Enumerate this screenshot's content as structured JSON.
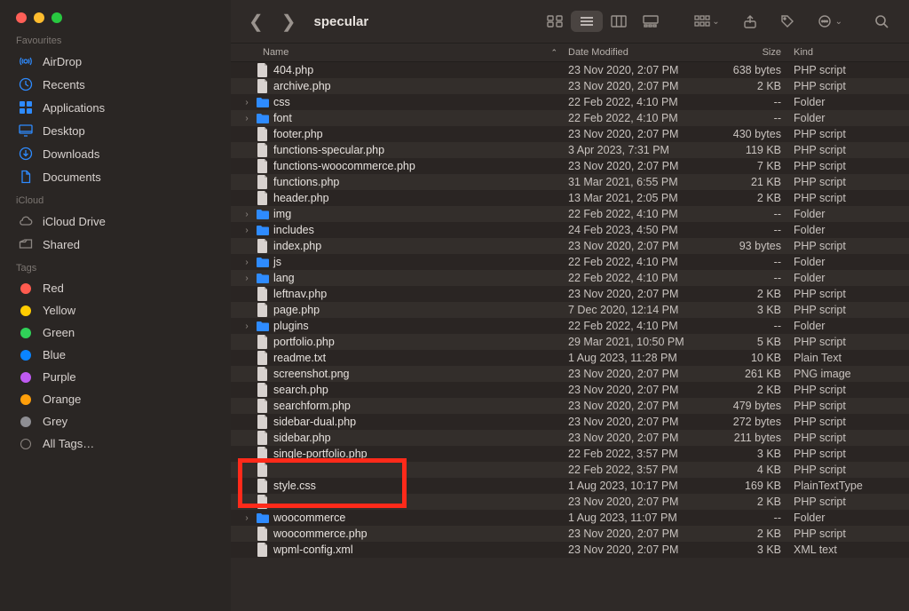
{
  "window": {
    "title": "specular"
  },
  "sidebar": {
    "sections": [
      {
        "label": "Favourites",
        "items": [
          {
            "icon": "airdrop",
            "label": "AirDrop"
          },
          {
            "icon": "clock",
            "label": "Recents"
          },
          {
            "icon": "apps",
            "label": "Applications"
          },
          {
            "icon": "desktop",
            "label": "Desktop"
          },
          {
            "icon": "download",
            "label": "Downloads"
          },
          {
            "icon": "doc",
            "label": "Documents"
          }
        ]
      },
      {
        "label": "iCloud",
        "items": [
          {
            "icon": "cloud",
            "label": "iCloud Drive"
          },
          {
            "icon": "shared",
            "label": "Shared"
          }
        ]
      },
      {
        "label": "Tags",
        "items": [
          {
            "icon": "dot",
            "color": "#ff5b4f",
            "label": "Red"
          },
          {
            "icon": "dot",
            "color": "#ffcc00",
            "label": "Yellow"
          },
          {
            "icon": "dot",
            "color": "#30d158",
            "label": "Green"
          },
          {
            "icon": "dot",
            "color": "#0a84ff",
            "label": "Blue"
          },
          {
            "icon": "dot",
            "color": "#bf5af2",
            "label": "Purple"
          },
          {
            "icon": "dot",
            "color": "#ff9f0a",
            "label": "Orange"
          },
          {
            "icon": "dot",
            "color": "#8e8e93",
            "label": "Grey"
          },
          {
            "icon": "alltags",
            "label": "All Tags…"
          }
        ]
      }
    ]
  },
  "columns": {
    "name": "Name",
    "date": "Date Modified",
    "size": "Size",
    "kind": "Kind",
    "sort_indicator": "⌃"
  },
  "files": [
    {
      "folder": false,
      "expandable": false,
      "name": "404.php",
      "date": "23 Nov 2020, 2:07 PM",
      "size": "638 bytes",
      "kind": "PHP script"
    },
    {
      "folder": false,
      "expandable": false,
      "name": "archive.php",
      "date": "23 Nov 2020, 2:07 PM",
      "size": "2 KB",
      "kind": "PHP script"
    },
    {
      "folder": true,
      "expandable": true,
      "name": "css",
      "date": "22 Feb 2022, 4:10 PM",
      "size": "--",
      "kind": "Folder"
    },
    {
      "folder": true,
      "expandable": true,
      "name": "font",
      "date": "22 Feb 2022, 4:10 PM",
      "size": "--",
      "kind": "Folder"
    },
    {
      "folder": false,
      "expandable": false,
      "name": "footer.php",
      "date": "23 Nov 2020, 2:07 PM",
      "size": "430 bytes",
      "kind": "PHP script"
    },
    {
      "folder": false,
      "expandable": false,
      "name": "functions-specular.php",
      "date": "3 Apr 2023, 7:31 PM",
      "size": "119 KB",
      "kind": "PHP script"
    },
    {
      "folder": false,
      "expandable": false,
      "name": "functions-woocommerce.php",
      "date": "23 Nov 2020, 2:07 PM",
      "size": "7 KB",
      "kind": "PHP script"
    },
    {
      "folder": false,
      "expandable": false,
      "name": "functions.php",
      "date": "31 Mar 2021, 6:55 PM",
      "size": "21 KB",
      "kind": "PHP script"
    },
    {
      "folder": false,
      "expandable": false,
      "name": "header.php",
      "date": "13 Mar 2021, 2:05 PM",
      "size": "2 KB",
      "kind": "PHP script"
    },
    {
      "folder": true,
      "expandable": true,
      "name": "img",
      "date": "22 Feb 2022, 4:10 PM",
      "size": "--",
      "kind": "Folder"
    },
    {
      "folder": true,
      "expandable": true,
      "name": "includes",
      "date": "24 Feb 2023, 4:50 PM",
      "size": "--",
      "kind": "Folder"
    },
    {
      "folder": false,
      "expandable": false,
      "name": "index.php",
      "date": "23 Nov 2020, 2:07 PM",
      "size": "93 bytes",
      "kind": "PHP script"
    },
    {
      "folder": true,
      "expandable": true,
      "name": "js",
      "date": "22 Feb 2022, 4:10 PM",
      "size": "--",
      "kind": "Folder"
    },
    {
      "folder": true,
      "expandable": true,
      "name": "lang",
      "date": "22 Feb 2022, 4:10 PM",
      "size": "--",
      "kind": "Folder"
    },
    {
      "folder": false,
      "expandable": false,
      "name": "leftnav.php",
      "date": "23 Nov 2020, 2:07 PM",
      "size": "2 KB",
      "kind": "PHP script"
    },
    {
      "folder": false,
      "expandable": false,
      "name": "page.php",
      "date": "7 Dec 2020, 12:14 PM",
      "size": "3 KB",
      "kind": "PHP script"
    },
    {
      "folder": true,
      "expandable": true,
      "name": "plugins",
      "date": "22 Feb 2022, 4:10 PM",
      "size": "--",
      "kind": "Folder"
    },
    {
      "folder": false,
      "expandable": false,
      "name": "portfolio.php",
      "date": "29 Mar 2021, 10:50 PM",
      "size": "5 KB",
      "kind": "PHP script"
    },
    {
      "folder": false,
      "expandable": false,
      "name": "readme.txt",
      "date": "1 Aug 2023, 11:28 PM",
      "size": "10 KB",
      "kind": "Plain Text"
    },
    {
      "folder": false,
      "expandable": false,
      "name": "screenshot.png",
      "date": "23 Nov 2020, 2:07 PM",
      "size": "261 KB",
      "kind": "PNG image"
    },
    {
      "folder": false,
      "expandable": false,
      "name": "search.php",
      "date": "23 Nov 2020, 2:07 PM",
      "size": "2 KB",
      "kind": "PHP script"
    },
    {
      "folder": false,
      "expandable": false,
      "name": "searchform.php",
      "date": "23 Nov 2020, 2:07 PM",
      "size": "479 bytes",
      "kind": "PHP script"
    },
    {
      "folder": false,
      "expandable": false,
      "name": "sidebar-dual.php",
      "date": "23 Nov 2020, 2:07 PM",
      "size": "272 bytes",
      "kind": "PHP script"
    },
    {
      "folder": false,
      "expandable": false,
      "name": "sidebar.php",
      "date": "23 Nov 2020, 2:07 PM",
      "size": "211 bytes",
      "kind": "PHP script"
    },
    {
      "folder": false,
      "expandable": false,
      "name": "single-portfolio.php",
      "date": "22 Feb 2022, 3:57 PM",
      "size": "3 KB",
      "kind": "PHP script"
    },
    {
      "folder": false,
      "expandable": false,
      "name": "",
      "date": "22 Feb 2022, 3:57 PM",
      "size": "4 KB",
      "kind": "PHP script"
    },
    {
      "folder": false,
      "expandable": false,
      "name": "style.css",
      "date": "1 Aug 2023, 10:17 PM",
      "size": "169 KB",
      "kind": "PlainTextType"
    },
    {
      "folder": false,
      "expandable": false,
      "name": "",
      "date": "23 Nov 2020, 2:07 PM",
      "size": "2 KB",
      "kind": "PHP script"
    },
    {
      "folder": true,
      "expandable": true,
      "name": "woocommerce",
      "date": "1 Aug 2023, 11:07 PM",
      "size": "--",
      "kind": "Folder"
    },
    {
      "folder": false,
      "expandable": false,
      "name": "woocommerce.php",
      "date": "23 Nov 2020, 2:07 PM",
      "size": "2 KB",
      "kind": "PHP script"
    },
    {
      "folder": false,
      "expandable": false,
      "name": "wpml-config.xml",
      "date": "23 Nov 2020, 2:07 PM",
      "size": "3 KB",
      "kind": "XML text"
    }
  ],
  "highlight": {
    "row_start": 25,
    "row_end": 27,
    "width": 190
  }
}
